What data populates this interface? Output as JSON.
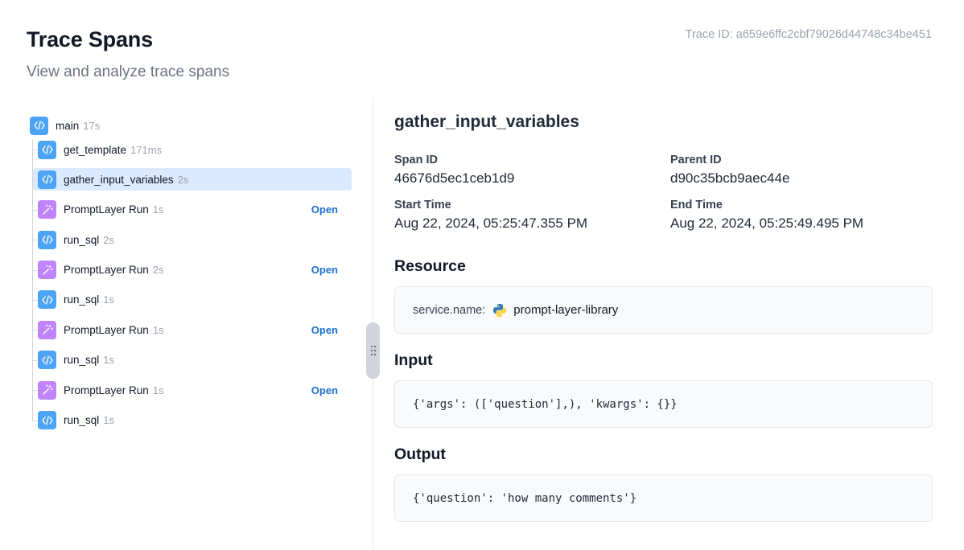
{
  "header": {
    "title": "Trace Spans",
    "subtitle": "View and analyze trace spans",
    "trace_id": "Trace ID: a659e6ffc2cbf79026d44748c34be451"
  },
  "tree": {
    "root": {
      "name": "main",
      "duration": "17s",
      "icon": "code-icon"
    },
    "open_label": "Open",
    "selected_index": 1,
    "children": [
      {
        "name": "get_template",
        "duration": "171ms",
        "icon": "code-icon"
      },
      {
        "name": "gather_input_variables",
        "duration": "2s",
        "icon": "code-icon"
      },
      {
        "name": "PromptLayer Run",
        "duration": "1s",
        "icon": "magic-wand-icon"
      },
      {
        "name": "run_sql",
        "duration": "2s",
        "icon": "code-icon"
      },
      {
        "name": "PromptLayer Run",
        "duration": "2s",
        "icon": "magic-wand-icon"
      },
      {
        "name": "run_sql",
        "duration": "1s",
        "icon": "code-icon"
      },
      {
        "name": "PromptLayer Run",
        "duration": "1s",
        "icon": "magic-wand-icon"
      },
      {
        "name": "run_sql",
        "duration": "1s",
        "icon": "code-icon"
      },
      {
        "name": "PromptLayer Run",
        "duration": "1s",
        "icon": "magic-wand-icon"
      },
      {
        "name": "run_sql",
        "duration": "1s",
        "icon": "code-icon"
      }
    ]
  },
  "detail": {
    "title": "gather_input_variables",
    "span_id_label": "Span ID",
    "span_id": "46676d5ec1ceb1d9",
    "parent_id_label": "Parent ID",
    "parent_id": "d90c35bcb9aec44e",
    "start_label": "Start Time",
    "start_time": "Aug 22, 2024, 05:25:47.355 PM",
    "end_label": "End Time",
    "end_time": "Aug 22, 2024, 05:25:49.495 PM",
    "resource_title": "Resource",
    "resource_key": "service.name:",
    "resource_value": "prompt-layer-library",
    "input_title": "Input",
    "input_value": "{'args': (['question'],), 'kwargs': {}}",
    "output_title": "Output",
    "output_value": "{'question': 'how many comments'}"
  },
  "colors": {
    "code_icon_bg": "#4da3f5",
    "wand_icon_bg": "#c084fc",
    "selected_bg": "#dbeafe",
    "link": "#1d6fd1"
  }
}
